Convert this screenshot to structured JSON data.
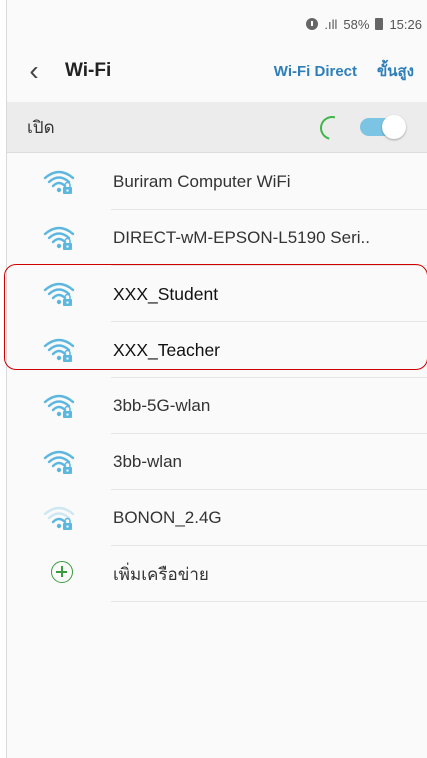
{
  "status": {
    "signal": ".ıll",
    "battery_pct": "58%",
    "time": "15:26"
  },
  "header": {
    "title": "Wi-Fi",
    "direct": "Wi-Fi Direct",
    "advanced": "ขั้นสูง"
  },
  "toggle": {
    "label": "เปิด",
    "on": true
  },
  "networks": [
    {
      "name": "Buriram Computer WiFi",
      "signal": "strong",
      "color": "#5bb7e0"
    },
    {
      "name": "DIRECT-wM-EPSON-L5190 Seri..",
      "signal": "strong",
      "color": "#5bb7e0"
    },
    {
      "name": "XXX_Student",
      "signal": "strong",
      "color": "#5bb7e0"
    },
    {
      "name": "XXX_Teacher",
      "signal": "strong",
      "color": "#5bb7e0"
    },
    {
      "name": "3bb-5G-wlan",
      "signal": "medium",
      "color": "#5bb7e0"
    },
    {
      "name": "3bb-wlan",
      "signal": "medium",
      "color": "#5bb7e0"
    },
    {
      "name": "BONON_2.4G",
      "signal": "weak",
      "color": "#5bb7e0"
    }
  ],
  "add_network": {
    "label": "เพิ่มเครือข่าย"
  },
  "colors": {
    "accent": "#2c7fb8",
    "highlight": "#d00000",
    "toggle_on": "#7cc4e3"
  }
}
